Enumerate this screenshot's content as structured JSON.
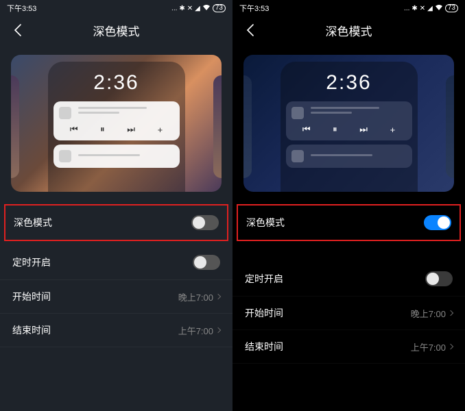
{
  "left": {
    "status_time": "下午3:53",
    "battery": "73",
    "header_title": "深色模式",
    "preview_clock": "2:36",
    "dark_mode_label": "深色模式",
    "dark_mode_on": false,
    "schedule_label": "定时开启",
    "schedule_on": false,
    "start_label": "开始时间",
    "start_value": "晚上7:00",
    "end_label": "结束时间",
    "end_value": "上午7:00"
  },
  "right": {
    "status_time": "下午3:53",
    "battery": "73",
    "header_title": "深色模式",
    "preview_clock": "2:36",
    "dark_mode_label": "深色模式",
    "dark_mode_on": true,
    "schedule_label": "定时开启",
    "schedule_on": false,
    "start_label": "开始时间",
    "start_value": "晚上7:00",
    "end_label": "结束时间",
    "end_value": "上午7:00"
  }
}
